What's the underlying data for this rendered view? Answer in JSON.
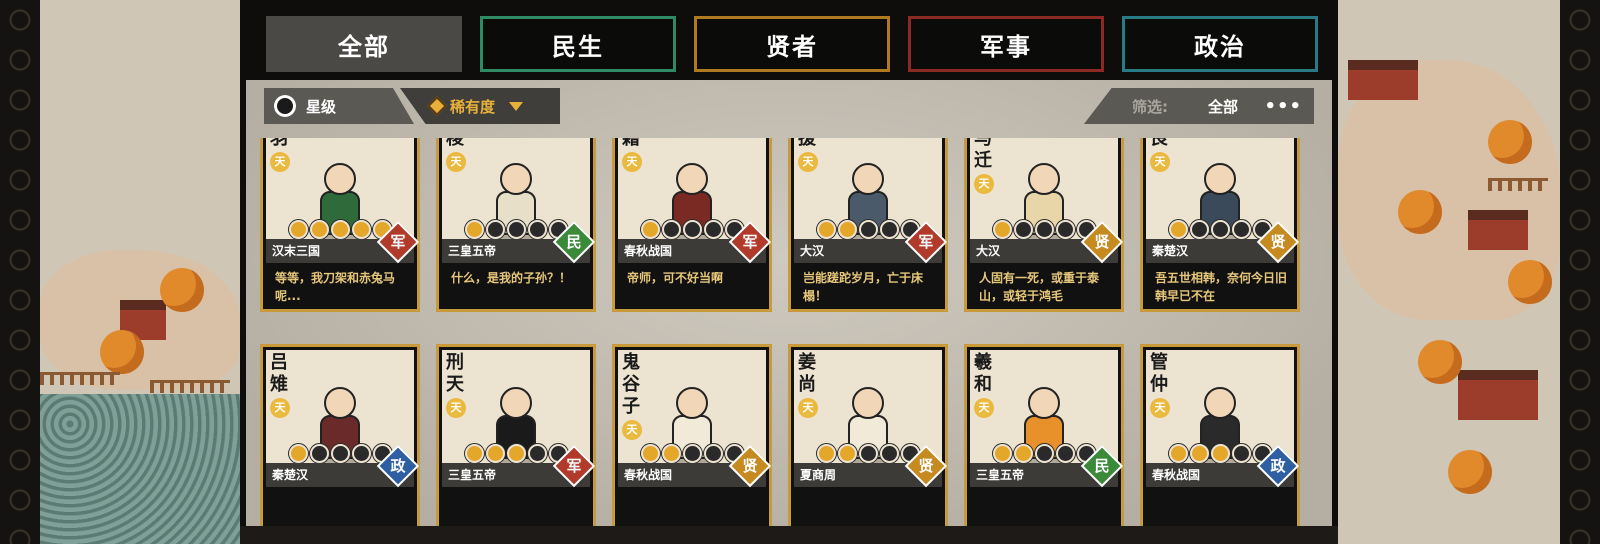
{
  "tabs": [
    {
      "label": "全部",
      "active": true,
      "border": "#4a4945"
    },
    {
      "label": "民生",
      "active": false,
      "border": "#2d8a62"
    },
    {
      "label": "贤者",
      "active": false,
      "border": "#b07a22"
    },
    {
      "label": "军事",
      "active": false,
      "border": "#8a2a22"
    },
    {
      "label": "政治",
      "active": false,
      "border": "#2a7a86"
    }
  ],
  "sort": {
    "star_label": "星级",
    "rarity_label": "稀有度"
  },
  "filter": {
    "label": "筛选:",
    "value": "全部",
    "more": "•••"
  },
  "tier_badge": "天",
  "cards": [
    {
      "name": "羽",
      "era": "汉末三国",
      "role": "军",
      "role_type": "jun",
      "stars": 5,
      "quote": "等等，我刀架和赤兔马呢...",
      "robe": "#2f6b3a"
    },
    {
      "name": "稷",
      "era": "三皇五帝",
      "role": "民",
      "role_type": "min",
      "stars": 1,
      "quote": "什么，是我的子孙？！",
      "robe": "#e8dfc8"
    },
    {
      "name": "籍",
      "era": "春秋战国",
      "role": "军",
      "role_type": "jun",
      "stars": 1,
      "quote": "帝师，可不好当啊",
      "robe": "#7a2a22"
    },
    {
      "name": "援",
      "era": "大汉",
      "role": "军",
      "role_type": "jun",
      "stars": 2,
      "quote": "岂能蹉跎岁月，亡于床榻！",
      "robe": "#4a5a6a"
    },
    {
      "name": "马迁",
      "era": "大汉",
      "role": "贤",
      "role_type": "xian",
      "stars": 1,
      "quote": "人固有一死，或重于泰山，或轻于鸿毛",
      "robe": "#e8d6a8"
    },
    {
      "name": "良",
      "era": "秦楚汉",
      "role": "贤",
      "role_type": "xian",
      "stars": 1,
      "quote": "吾五世相韩，奈何今日旧韩早已不在",
      "robe": "#3a4a5a"
    },
    {
      "name": "吕雉",
      "era": "秦楚汉",
      "role": "政",
      "role_type": "zheng",
      "stars": 1,
      "quote": "",
      "robe": "#6a2a2a"
    },
    {
      "name": "刑天",
      "era": "三皇五帝",
      "role": "军",
      "role_type": "jun",
      "stars": 3,
      "quote": "",
      "robe": "#1a1a1a"
    },
    {
      "name": "鬼谷子",
      "era": "春秋战国",
      "role": "贤",
      "role_type": "xian",
      "stars": 2,
      "quote": "",
      "robe": "#f2ead8"
    },
    {
      "name": "姜尚",
      "era": "夏商周",
      "role": "贤",
      "role_type": "xian",
      "stars": 2,
      "quote": "",
      "robe": "#f2ead8"
    },
    {
      "name": "羲和",
      "era": "三皇五帝",
      "role": "民",
      "role_type": "min",
      "stars": 2,
      "quote": "",
      "robe": "#e8902a"
    },
    {
      "name": "管仲",
      "era": "春秋战国",
      "role": "政",
      "role_type": "zheng",
      "stars": 3,
      "quote": "",
      "robe": "#2a2a2a"
    }
  ]
}
